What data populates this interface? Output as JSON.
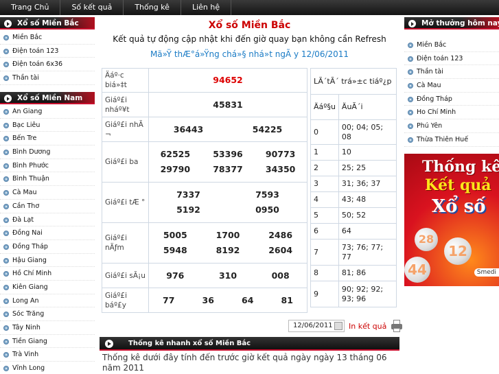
{
  "nav": [
    "Trang Chủ",
    "Số kết quả",
    "Thống kê",
    "Liên hệ"
  ],
  "left_north": {
    "title": "Xổ số Miền Bắc",
    "items": [
      "Miền Bắc",
      "Điện toán 123",
      "Điện toán 6x36",
      "Thần tài"
    ]
  },
  "left_south": {
    "title": "Xổ số Miền Nam",
    "items": [
      "An Giang",
      "Bạc Liêu",
      "Bến Tre",
      "Bình Dương",
      "Bình Phước",
      "Bình Thuận",
      "Cà Mau",
      "Cần Thơ",
      "Đà Lạt",
      "Đồng Nai",
      "Đồng Tháp",
      "Hậu Giang",
      "Hồ Chí Minh",
      "Kiên Giang",
      "Long An",
      "Sóc Trăng",
      "Tây Ninh",
      "Tiền Giang",
      "Trà Vinh",
      "Vĩnh Long"
    ]
  },
  "right_today": {
    "title": "Mở thưởng hôm nay",
    "items": [
      "Miền Bắc",
      "Điện toán 123",
      "Thần tài",
      "Cà Mau",
      "Đồng Tháp",
      "Ho Chí Minh",
      "Phú Yên",
      "Thừa Thiên Huế"
    ]
  },
  "main": {
    "title": "Xổ số Miền Bắc",
    "subtitle": "Kết quả tự động cập nhật khi đến giờ quay bạn không cần Refresh",
    "date_line": "Mã»Ÿ thÆ°á»Ÿng chá»§ nhá»t ngÃ y 12/06/2011"
  },
  "results": [
    {
      "label": "Äáº·c biá»‡t",
      "rows": [
        [
          "94652"
        ]
      ],
      "special": true
    },
    {
      "label": "Giáº£i nháº¥t",
      "rows": [
        [
          "45831"
        ]
      ]
    },
    {
      "label": "Giáº£i nhÃ ¬",
      "rows": [
        [
          "36443",
          "54225"
        ]
      ]
    },
    {
      "label": "Giáº£i ba",
      "rows": [
        [
          "62525",
          "53396",
          "90773"
        ],
        [
          "29790",
          "78377",
          "34350"
        ]
      ]
    },
    {
      "label": "Giáº£i tÆ °",
      "rows": [
        [
          "7337",
          "7593"
        ],
        [
          "5192",
          "0950"
        ]
      ]
    },
    {
      "label": "Giáº£i nÄƒm",
      "rows": [
        [
          "5005",
          "1700",
          "2486"
        ],
        [
          "5948",
          "8192",
          "2604"
        ]
      ]
    },
    {
      "label": "Giáº£i sÃ¡u",
      "rows": [
        [
          "976",
          "310",
          "008"
        ]
      ]
    },
    {
      "label": "Giáº£i báº£y",
      "rows": [
        [
          "77",
          "36",
          "64",
          "81"
        ]
      ]
    }
  ],
  "loto": {
    "header": "LÃ´tÃ´ trá»±c tiáº¿p",
    "col_head": "Äáº§u",
    "col_tail": "ÄuÃ´i",
    "rows": [
      {
        "d": "0",
        "v": "00; 04; 05; 08"
      },
      {
        "d": "1",
        "v": "10"
      },
      {
        "d": "2",
        "v": "25; 25"
      },
      {
        "d": "3",
        "v": "31; 36; 37"
      },
      {
        "d": "4",
        "v": "43; 48"
      },
      {
        "d": "5",
        "v": "50; 52"
      },
      {
        "d": "6",
        "v": "64"
      },
      {
        "d": "7",
        "v": "73; 76; 77; 77"
      },
      {
        "d": "8",
        "v": "81; 86"
      },
      {
        "d": "9",
        "v": "90; 92; 92; 93; 96"
      }
    ]
  },
  "date_picker": {
    "value": "12/06/2011",
    "print_label": "In kết quả"
  },
  "stats": {
    "header": "Thống kê nhanh xổ số Miền Bắc",
    "text": "Thống kê dưới đây tính đến trước giờ kết quả ngày ngày 13 tháng 06 năm 2011"
  },
  "banner": {
    "line1": "Thống kê",
    "line2": "Kết quả",
    "line3": "Xổ số",
    "balls": [
      "28",
      "12",
      "44"
    ],
    "brand": "Smedi"
  },
  "colors": {
    "accent_red": "#c8102e",
    "link_blue": "#1a7bc5",
    "special_red": "#dd0000"
  }
}
